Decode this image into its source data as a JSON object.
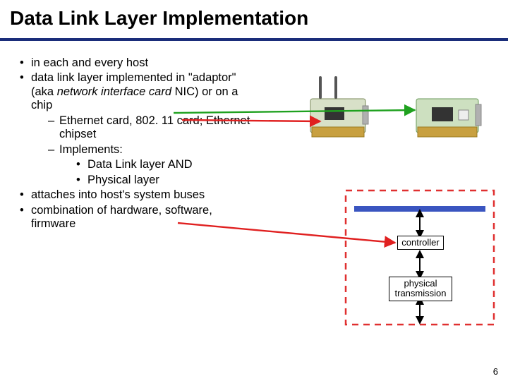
{
  "title": "Data Link Layer Implementation",
  "bullets": {
    "b1": "in each and every host",
    "b2_pre": "data link layer implemented in \"adaptor\" (aka ",
    "b2_em": "network interface card",
    "b2_post": " NIC) or on a chip",
    "b2a": "Ethernet card, 802. 11 card; Ethernet chipset",
    "b2b": "Implements:",
    "b2b1": "Data Link layer AND",
    "b2b2": "Physical layer",
    "b3": "attaches into host's system buses",
    "b4": "combination of hardware, software, firmware"
  },
  "labels": {
    "controller": "controller",
    "physical": "physical\ntransmission"
  },
  "page_number": "6",
  "colors": {
    "rule": "#1a2d7a",
    "bus": "#3a55c0",
    "green_arrow": "#1fa11f",
    "red_arrow": "#e02020",
    "dash": "#e03030"
  }
}
